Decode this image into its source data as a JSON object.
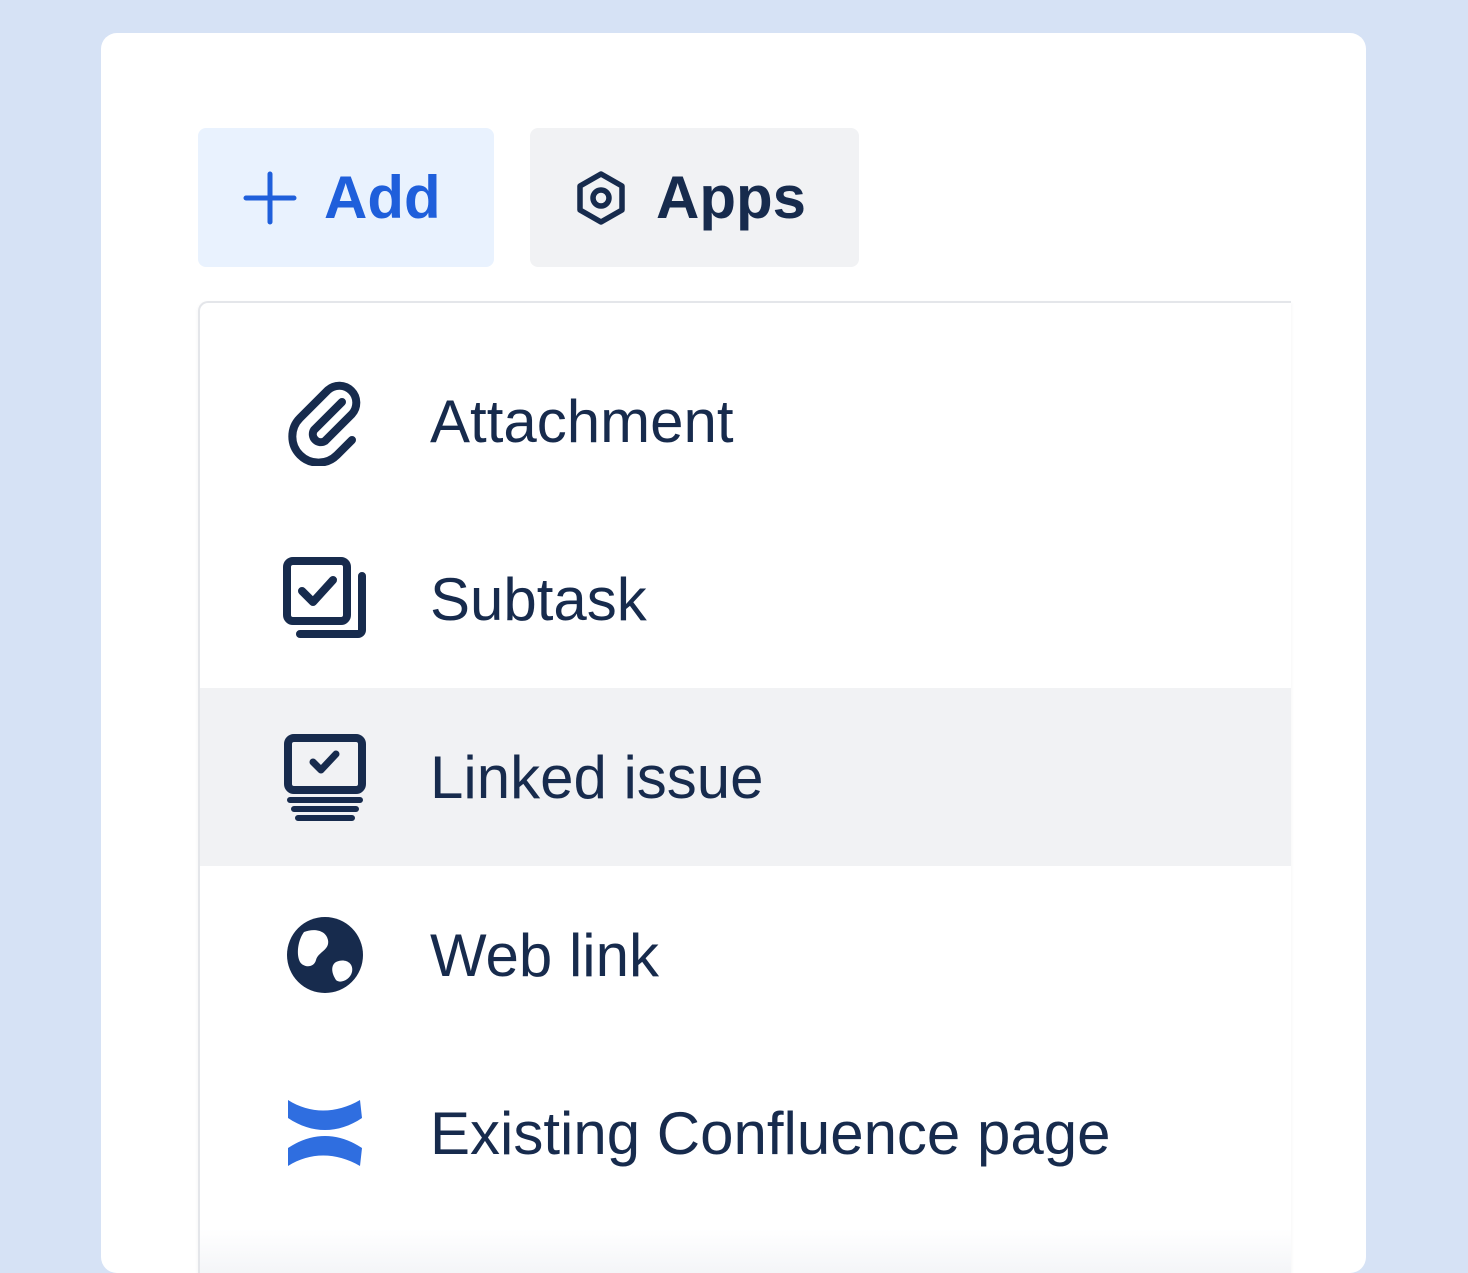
{
  "toolbar": {
    "add_label": "Add",
    "apps_label": "Apps"
  },
  "menu": {
    "items": [
      {
        "label": "Attachment",
        "icon": "paperclip-icon"
      },
      {
        "label": "Subtask",
        "icon": "subtask-icon"
      },
      {
        "label": "Linked issue",
        "icon": "linked-issue-icon",
        "hovered": true
      },
      {
        "label": "Web link",
        "icon": "globe-icon"
      },
      {
        "label": "Existing Confluence page",
        "icon": "confluence-icon"
      }
    ]
  },
  "colors": {
    "background": "#d6e2f5",
    "add_button_bg": "#e9f2fe",
    "add_button_text": "#1f5fdb",
    "apps_button_bg": "#f1f2f4",
    "text": "#172b4d",
    "hover_bg": "#f1f2f4",
    "confluence_blue": "#2f6ee0"
  }
}
